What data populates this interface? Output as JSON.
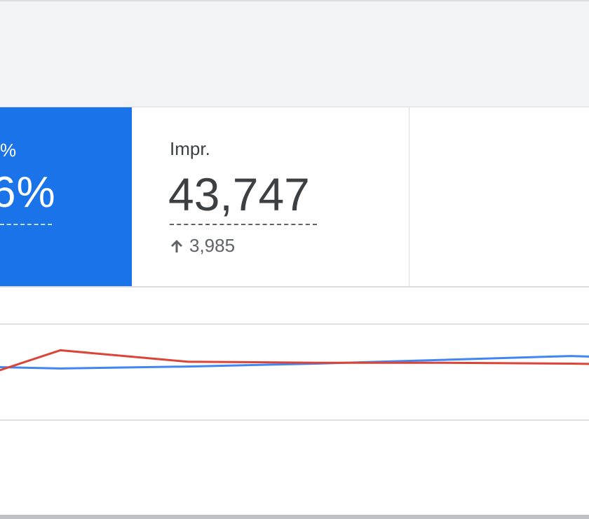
{
  "scorecards": {
    "selected": {
      "label": "%",
      "value": "6%",
      "color": "#1a73e8"
    },
    "impressions": {
      "label": "Impr.",
      "value": "43,747",
      "delta": "3,985",
      "delta_icon": "arrow-up-icon"
    }
  },
  "chart_data": {
    "type": "line",
    "series": [
      {
        "color": "#4285f4",
        "values": [
          6,
          3,
          5,
          8,
          12,
          16,
          12,
          8,
          7,
          5
        ]
      },
      {
        "color": "#db4437",
        "values": [
          -22,
          22,
          10,
          9,
          9,
          8,
          6,
          8,
          13,
          -2
        ]
      }
    ],
    "ylim": [
      -50,
      50
    ]
  }
}
